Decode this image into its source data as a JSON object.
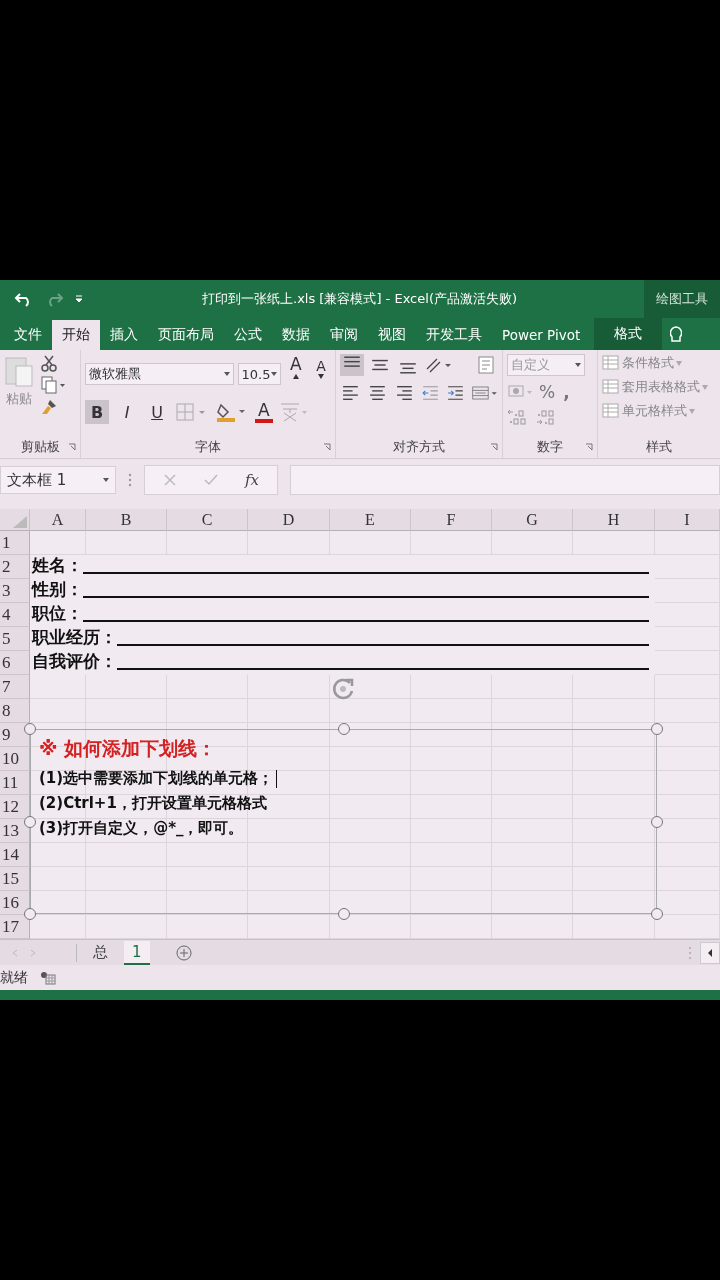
{
  "window": {
    "title": "打印到一张纸上.xls  [兼容模式] - Excel(产品激活失败)",
    "context_label": "绘图工具"
  },
  "tabs": [
    {
      "label": "文件",
      "selected": false,
      "kind": "normal"
    },
    {
      "label": "开始",
      "selected": true,
      "kind": "normal"
    },
    {
      "label": "插入",
      "selected": false,
      "kind": "normal"
    },
    {
      "label": "页面布局",
      "selected": false,
      "kind": "normal"
    },
    {
      "label": "公式",
      "selected": false,
      "kind": "normal"
    },
    {
      "label": "数据",
      "selected": false,
      "kind": "normal"
    },
    {
      "label": "审阅",
      "selected": false,
      "kind": "normal"
    },
    {
      "label": "视图",
      "selected": false,
      "kind": "normal"
    },
    {
      "label": "开发工具",
      "selected": false,
      "kind": "normal"
    },
    {
      "label": "Power Pivot",
      "selected": false,
      "kind": "normal"
    },
    {
      "label": "格式",
      "selected": false,
      "kind": "context"
    }
  ],
  "ribbon": {
    "clipboard": {
      "paste": "粘贴",
      "title": "剪贴板"
    },
    "font": {
      "name": "微软雅黑",
      "size": "10.5",
      "grow": "A",
      "shrink": "A",
      "font_color": "A",
      "title": "字体",
      "styles": [
        {
          "label": "B",
          "selected": true
        },
        {
          "label": "I",
          "selected": false
        },
        {
          "label": "U",
          "selected": false
        }
      ]
    },
    "alignment": {
      "title": "对齐方式",
      "vertical": [
        {
          "kind": "top",
          "selected": true
        },
        {
          "kind": "middle",
          "selected": false
        },
        {
          "kind": "bottom",
          "selected": false
        }
      ],
      "horizontal": [
        {
          "kind": "left",
          "selected": false
        },
        {
          "kind": "center",
          "selected": false
        },
        {
          "kind": "right",
          "selected": false
        }
      ]
    },
    "number": {
      "format": "自定义",
      "percent": "%",
      "comma": ",",
      "title": "数字"
    },
    "styles": {
      "items": [
        "条件格式",
        "套用表格格式",
        "单元格样式"
      ],
      "title": "样式"
    }
  },
  "formula_bar": {
    "name_box": "文本框 1",
    "fx": "fx"
  },
  "columns": [
    "A",
    "B",
    "C",
    "D",
    "E",
    "F",
    "G",
    "H",
    "I"
  ],
  "rows": [
    "1",
    "2",
    "3",
    "4",
    "5",
    "6",
    "7",
    "8",
    "9",
    "10",
    "11",
    "12",
    "13",
    "14",
    "15",
    "16",
    "17"
  ],
  "form_fields": [
    {
      "label": "姓名："
    },
    {
      "label": "性别："
    },
    {
      "label": "职位："
    },
    {
      "label": "职业经历："
    },
    {
      "label": "自我评价："
    }
  ],
  "textbox": {
    "selected": true,
    "heading": "※ 如何添加下划线：",
    "lines": [
      "(1)选中需要添加下划线的单元格；",
      "(2)Ctrl+1，打开设置单元格格式",
      "(3)打开自定义，@*_，即可。"
    ]
  },
  "sheet_tabs": [
    {
      "label": "总",
      "selected": false
    },
    {
      "label": "1",
      "selected": true
    }
  ],
  "status": "就绪"
}
